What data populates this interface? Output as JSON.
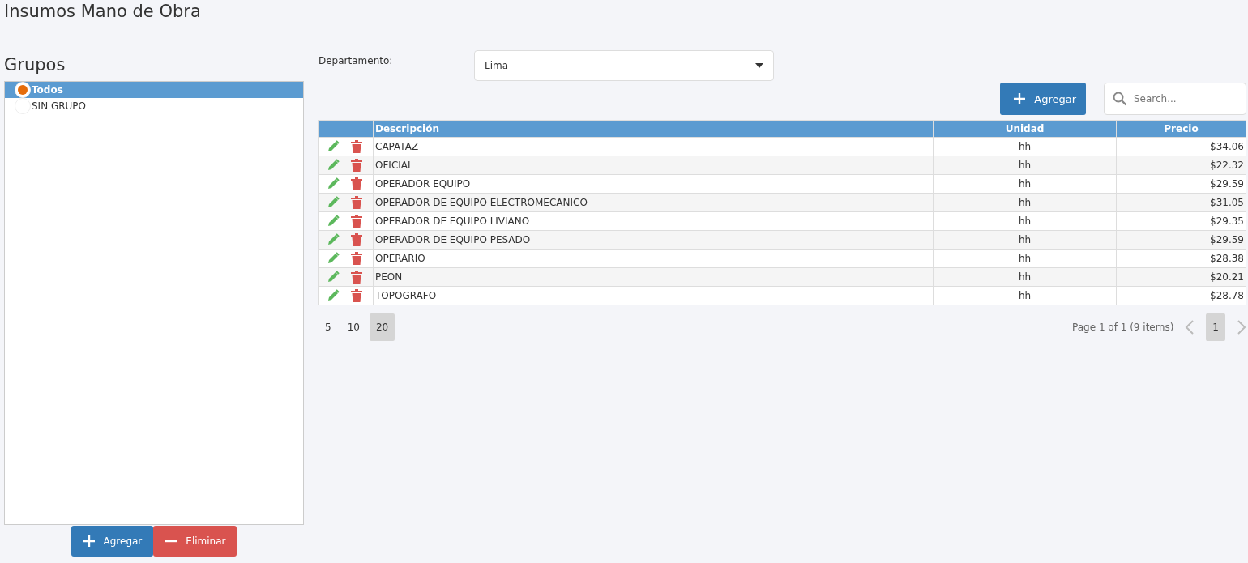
{
  "title": "Insumos Mano de Obra",
  "groups": {
    "title": "Grupos",
    "items": [
      {
        "label": "Todos",
        "selected": true
      },
      {
        "label": "SIN GRUPO",
        "selected": false
      }
    ],
    "buttons": [
      {
        "label": "Agregar",
        "kind": "add"
      },
      {
        "label": "Eliminar",
        "kind": "delete"
      }
    ]
  },
  "department": {
    "label": "Departamento:",
    "value": "Lima"
  },
  "toolbar": {
    "add_label": "Agregar",
    "search_placeholder": "Search..."
  },
  "table": {
    "columns": [
      "Descripción",
      "Unidad",
      "Precio"
    ],
    "rows": [
      [
        "CAPATAZ",
        "hh",
        "$34.06"
      ],
      [
        "OFICIAL",
        "hh",
        "$22.32"
      ],
      [
        "OPERADOR EQUIPO",
        "hh",
        "$29.59"
      ],
      [
        "OPERADOR DE EQUIPO ELECTROMECANICO",
        "hh",
        "$31.05"
      ],
      [
        "OPERADOR DE EQUIPO LIVIANO",
        "hh",
        "$29.35"
      ],
      [
        "OPERADOR DE EQUIPO PESADO",
        "hh",
        "$29.59"
      ],
      [
        "OPERARIO",
        "hh",
        "$28.38"
      ],
      [
        "PEON",
        "hh",
        "$20.21"
      ],
      [
        "TOPOGRAFO",
        "hh",
        "$28.78"
      ]
    ]
  },
  "pager": {
    "sizes": [
      {
        "label": "5",
        "selected": false
      },
      {
        "label": "10",
        "selected": false
      },
      {
        "label": "20",
        "selected": true
      }
    ],
    "info": "Page 1 of 1 (9 items)",
    "pages": [
      {
        "label": "1",
        "selected": true
      }
    ]
  }
}
